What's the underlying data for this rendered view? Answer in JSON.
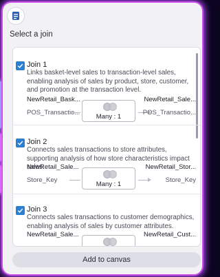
{
  "dialog": {
    "title": "Select a join",
    "add_button_label": "Add to canvas"
  },
  "joins": [
    {
      "name": "Join 1",
      "description": "Links basket-level sales to transaction-level sales, enabling analysis of sales by product, store, customer, and promotion at the transaction level.",
      "left_table": "NewRetail_Bask...",
      "left_key": "POS_Transactio...",
      "right_table": "NewRetail_Sale...",
      "right_key": "POS_Transactio...",
      "cardinality": "Many : 1",
      "checked": true
    },
    {
      "name": "Join 2",
      "description": "Connects sales transactions to store attributes, supporting analysis of how store characteristics impact sales.",
      "left_table": "NewRetail_Sale...",
      "left_key": "Store_Key",
      "right_table": "NewRetail_Stor...",
      "right_key": "Store_Key",
      "cardinality": "Many : 1",
      "checked": true
    },
    {
      "name": "Join 3",
      "description": "Connects sales transactions to customer demographics, enabling analysis of sales by customer attributes.",
      "left_table": "NewRetail_Sale...",
      "left_key": "",
      "right_table": "NewRetail_Cust...",
      "right_key": "",
      "cardinality": "",
      "checked": true
    }
  ],
  "colors": {
    "accent": "#2b80d3",
    "frame_glow": "#c94fe8",
    "background": "#0b0420"
  },
  "icons": {
    "logo": "app-logo-icon",
    "checkbox": "checkmark-icon",
    "join_type": "venn-join-icon"
  }
}
